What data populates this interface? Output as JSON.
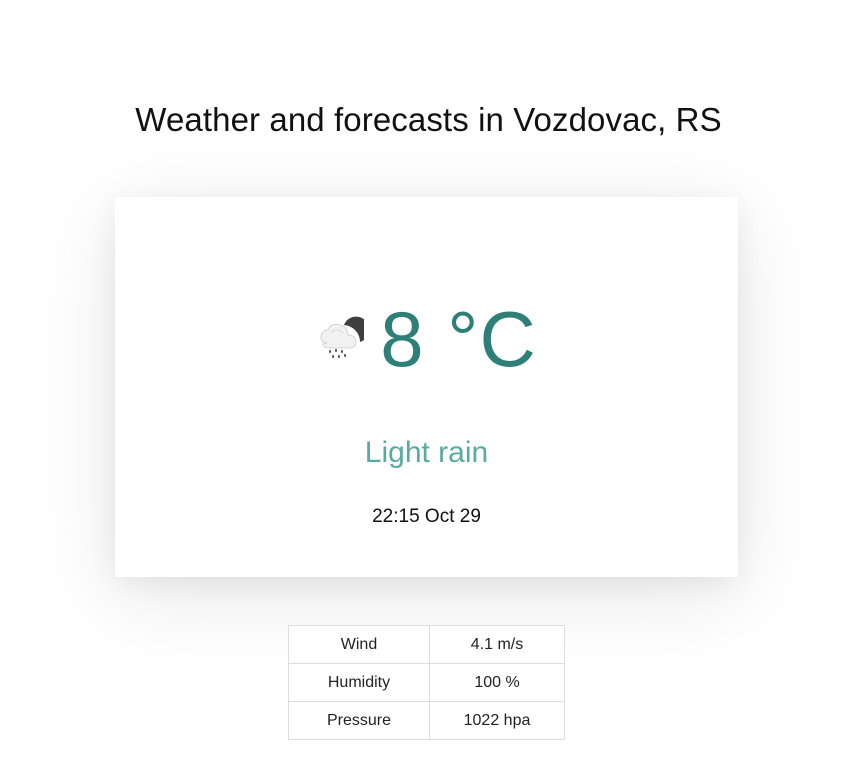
{
  "header": {
    "title": "Weather and forecasts in Vozdovac, RS"
  },
  "current": {
    "icon": "night-light-rain-icon",
    "temperature": "8 °C",
    "condition": "Light rain",
    "timestamp": "22:15 Oct 29"
  },
  "details": {
    "rows": [
      {
        "label": "Wind",
        "value": "4.1 m/s"
      },
      {
        "label": "Humidity",
        "value": "100 %"
      },
      {
        "label": "Pressure",
        "value": "1022 hpa"
      }
    ]
  },
  "colors": {
    "temperature": "#2f7f79",
    "condition": "#58aaa3",
    "border": "#dddddd"
  }
}
